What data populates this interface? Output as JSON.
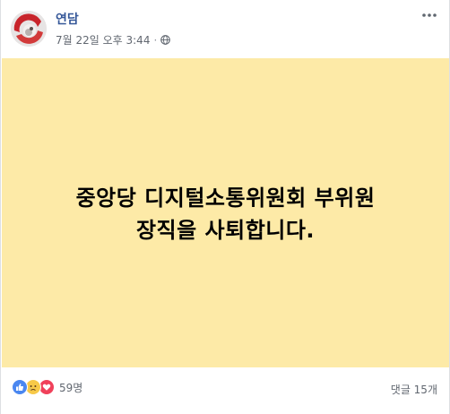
{
  "post": {
    "author": "연담",
    "timestamp": "7월 22일 오후 3:44",
    "separator": "·",
    "privacy_icon": "globe-icon",
    "more_icon": "more-options-icon",
    "banner_text": "중앙당 디지털소통위원회 부위원\n장직을 사퇴합니다.",
    "banner_color": "#fdeaa7"
  },
  "footer": {
    "reaction_icons": [
      "like-icon",
      "sad-icon",
      "love-icon"
    ],
    "reaction_count": "59명",
    "comment_count": "댓글 15개"
  },
  "colors": {
    "author_link": "#365899",
    "like": "#4a87f0",
    "love": "#f0415a",
    "sad": "#f7c948"
  }
}
